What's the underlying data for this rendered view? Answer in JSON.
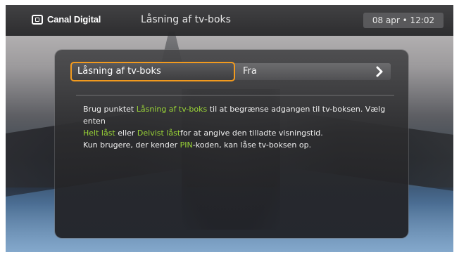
{
  "header": {
    "brand": "Canal Digital",
    "title": "Låsning af tv-boks",
    "clock": "08 apr • 12:02"
  },
  "setting": {
    "name": "Låsning af tv-boks",
    "value": "Fra"
  },
  "description": {
    "line1_pre": "Brug punktet ",
    "line1_hl": "Låsning af tv-boks",
    "line1_post": " til at begrænse adgangen til tv-boksen. Vælg enten",
    "line2_hl1": "Helt låst",
    "line2_mid": " eller ",
    "line2_hl2": "Delvist låst",
    "line2_post": "for at angive den tilladte visningstid.",
    "line3_pre": "Kun brugere, der kender ",
    "line3_hl": "PIN",
    "line3_post": "-koden, kan låse tv-boksen op."
  },
  "colors": {
    "focus": "#f29a1e",
    "highlight": "#9ad437"
  },
  "icons": {
    "brand": "canal-digital-logo-icon",
    "next": "chevron-right-icon"
  }
}
